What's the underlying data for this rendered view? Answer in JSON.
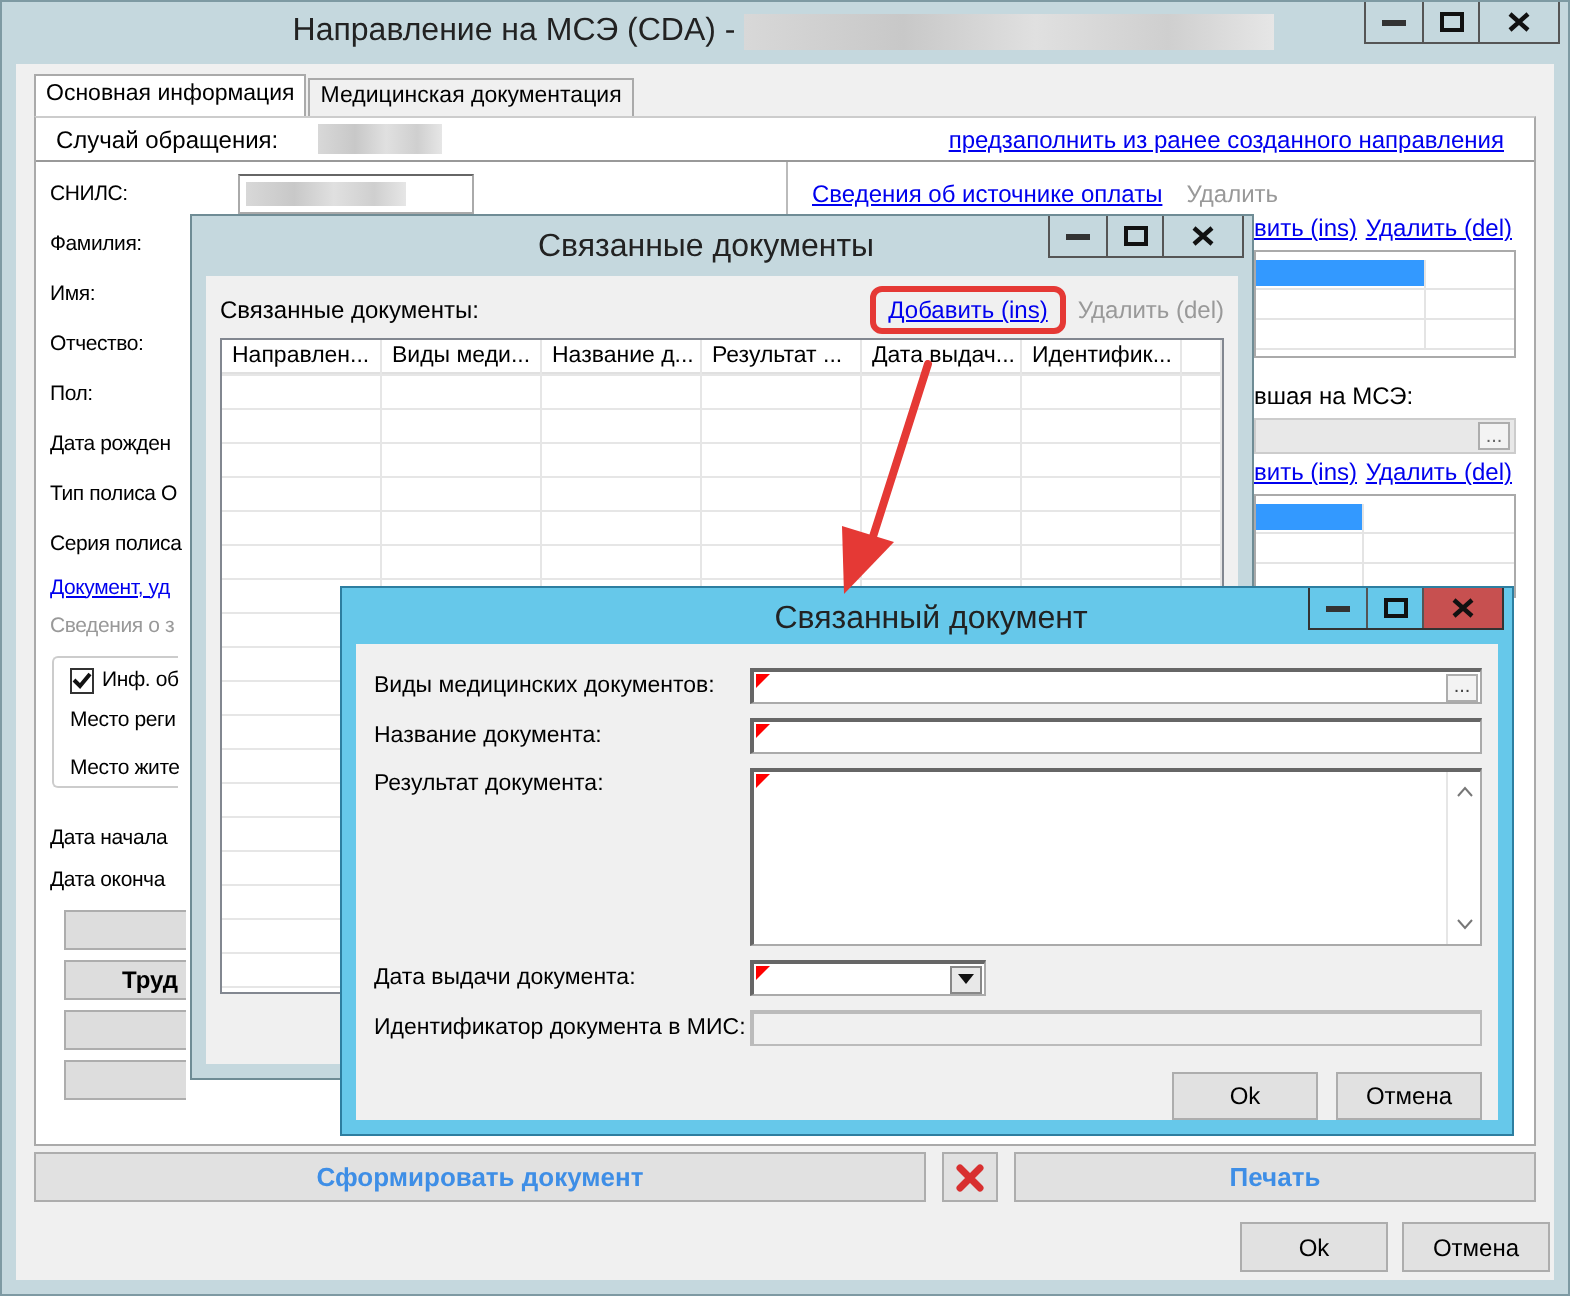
{
  "main_window": {
    "title": "Направление на МСЭ (CDA) -",
    "tabs": [
      {
        "label": "Основная информация",
        "selected": true
      },
      {
        "label": "Медицинская документация",
        "selected": false
      }
    ],
    "case_label": "Случай обращения:",
    "prefill_link": "предзаполнить из ранее созданного направления",
    "snils_label": "СНИЛС:",
    "labels": [
      "Фамилия:",
      "Имя:",
      "Отчество:",
      "Пол:",
      "Дата рожден",
      "Тип полиса О",
      "Серия полиса"
    ],
    "document_link": "Документ, уд",
    "section_label": {
      "text": "Сведения о з",
      "disabled": true
    },
    "group": {
      "checkbox": {
        "label": "Инф. об",
        "checked": true
      },
      "labels": [
        "Место реги",
        "Место жите"
      ]
    },
    "date_labels": [
      "Дата начала",
      "Дата оконча"
    ],
    "side_buttons": [
      {
        "kind": "blank"
      },
      {
        "kind": "label",
        "label": "Труд"
      },
      {
        "kind": "blank"
      },
      {
        "kind": "blank"
      }
    ],
    "payment_link": "Сведения об источнике оплаты",
    "payment_delete": {
      "label": "Удалить",
      "disabled": true
    },
    "right_items": [
      {
        "kind": "links",
        "add": "вить (ins)",
        "delete": "Удалить (del)"
      },
      {
        "kind": "table",
        "rows": [
          {
            "selected": true
          },
          {
            "selected": false
          },
          {
            "selected": false
          }
        ]
      },
      {
        "kind": "label",
        "text": "вшая на МСЭ:"
      },
      {
        "kind": "picker",
        "button": "..."
      },
      {
        "kind": "links",
        "add": "вить (ins)",
        "delete": "Удалить (del)"
      },
      {
        "kind": "table",
        "rows": [
          {
            "selected": true
          },
          {
            "selected": false
          },
          {
            "selected": false
          }
        ]
      }
    ],
    "generate_button": "Сформировать документ",
    "print_button": "Печать",
    "buttons": [
      "Ok",
      "Отмена"
    ]
  },
  "list_dialog": {
    "title": "Связанные документы",
    "label": "Связанные документы:",
    "add_link": {
      "label": "Добавить (ins)",
      "highlighted": true
    },
    "delete_link": {
      "label": "Удалить (del)",
      "disabled": true
    },
    "columns": [
      "Направлен...",
      "Виды меди...",
      "Название д...",
      "Результат ...",
      "Дата выдач...",
      "Идентифик..."
    ]
  },
  "item_dialog": {
    "title": "Связанный документ",
    "fields": [
      {
        "label": "Виды медицинских документов:",
        "kind": "picker",
        "button": "...",
        "required": true,
        "disabled": false
      },
      {
        "label": "Название документа:",
        "kind": "text",
        "required": true,
        "disabled": false
      },
      {
        "label": "Результат документа:",
        "kind": "memo",
        "required": true,
        "disabled": false
      },
      {
        "label": "Дата выдачи документа:",
        "kind": "date",
        "required": true,
        "disabled": false
      },
      {
        "label": "Идентификатор документа в МИС:",
        "kind": "text",
        "required": false,
        "disabled": true
      }
    ],
    "buttons": [
      "Ok",
      "Отмена"
    ]
  }
}
